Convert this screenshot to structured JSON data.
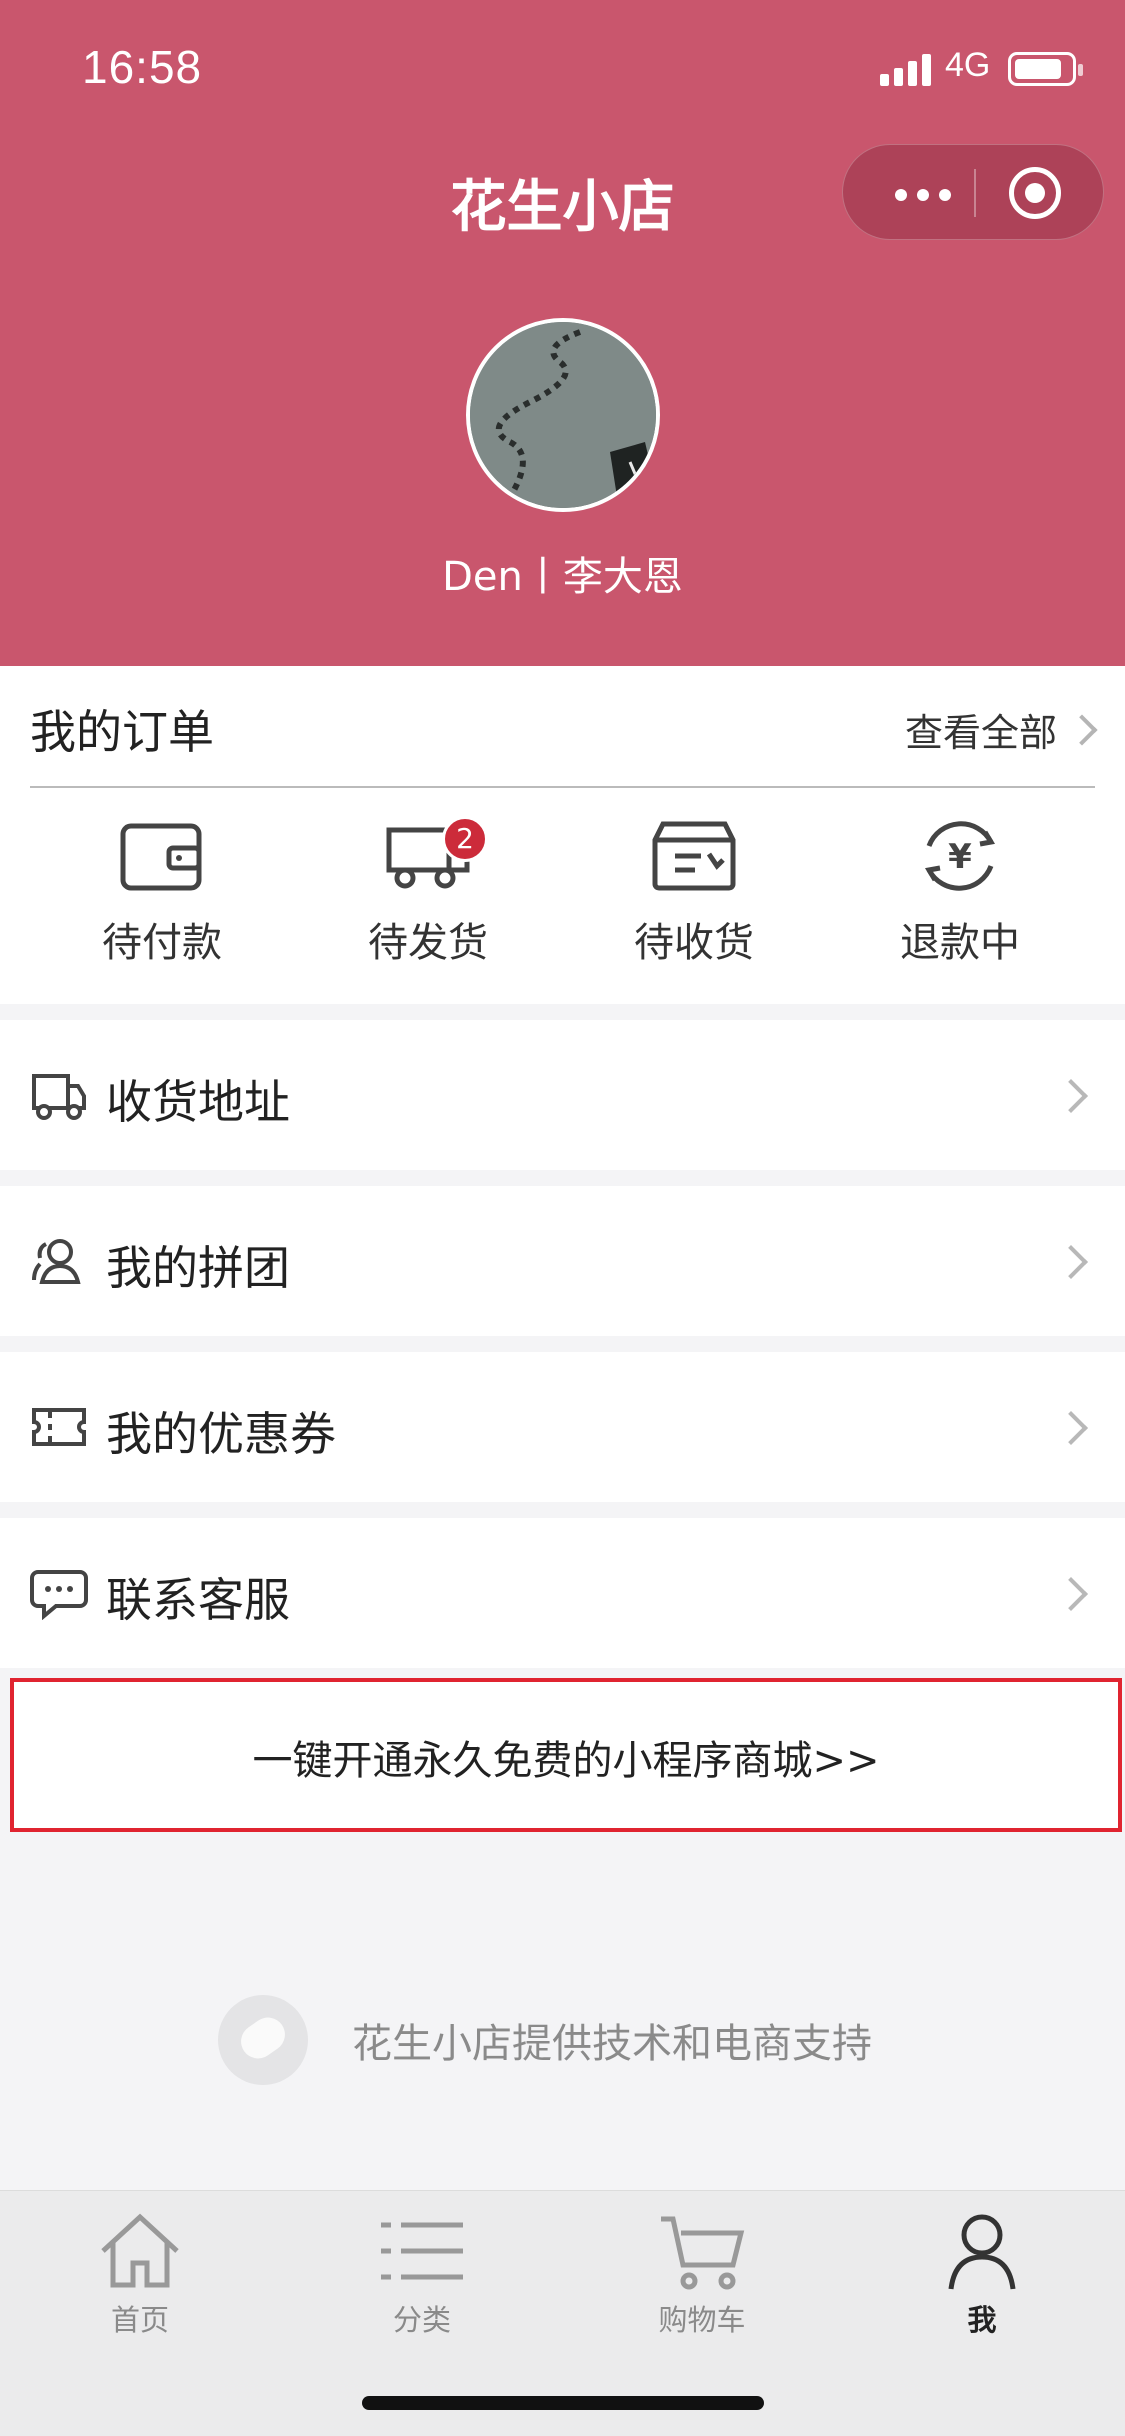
{
  "status_bar": {
    "time": "16:58",
    "network": "4G"
  },
  "header": {
    "title": "花生小店",
    "username": "Den丨李大恩"
  },
  "orders": {
    "title": "我的订单",
    "view_all": "查看全部",
    "statuses": [
      {
        "label": "待付款",
        "icon": "wallet-icon"
      },
      {
        "label": "待发货",
        "icon": "delivery-truck-icon",
        "badge": "2"
      },
      {
        "label": "待收货",
        "icon": "package-box-icon"
      },
      {
        "label": "退款中",
        "icon": "refund-yuan-icon"
      }
    ]
  },
  "menu": [
    {
      "label": "收货地址",
      "icon": "truck-address-icon"
    },
    {
      "label": "我的拼团",
      "icon": "group-users-icon"
    },
    {
      "label": "我的优惠券",
      "icon": "coupon-ticket-icon"
    },
    {
      "label": "联系客服",
      "icon": "chat-bubble-icon"
    }
  ],
  "promo": {
    "text": "一键开通永久免费的小程序商城>>"
  },
  "support": {
    "text": "花生小店提供技术和电商支持"
  },
  "tabbar": {
    "tabs": [
      {
        "label": "首页",
        "icon": "home-icon"
      },
      {
        "label": "分类",
        "icon": "category-list-icon"
      },
      {
        "label": "购物车",
        "icon": "shopping-cart-icon"
      },
      {
        "label": "我",
        "icon": "user-profile-icon",
        "active": true
      }
    ]
  },
  "colors": {
    "header_bg": "#c9566d",
    "badge": "#cc2b3a",
    "promo_border": "#e02430"
  }
}
